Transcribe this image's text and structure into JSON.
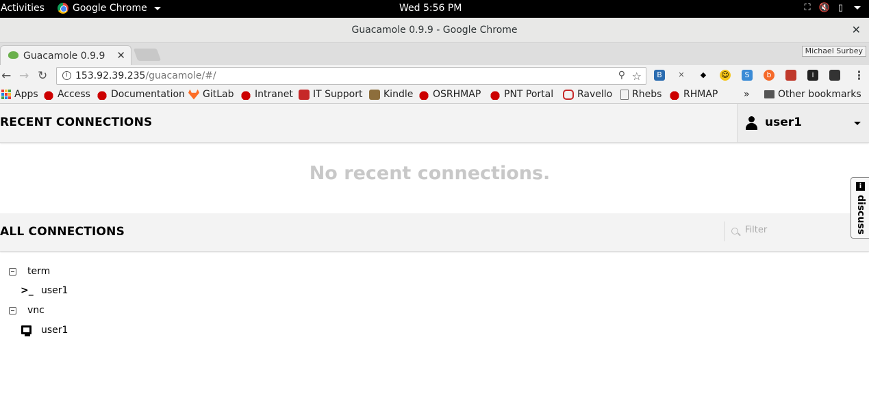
{
  "os_bar": {
    "activities": "Activities",
    "app_name": "Google Chrome",
    "clock": "Wed  5:56 PM"
  },
  "window": {
    "title": "Guacamole 0.9.9 - Google Chrome",
    "close": "✕"
  },
  "tabs": [
    {
      "label": "Guacamole 0.9.9",
      "close": "✕"
    }
  ],
  "profile_name": "Michael Surbey",
  "address": {
    "host": "153.92.39.235",
    "path": "/guacamole/#/"
  },
  "bookmarks": [
    {
      "label": "Apps",
      "icon": "apps-grid-icon"
    },
    {
      "label": "Access",
      "icon": "redhat-icon"
    },
    {
      "label": "Documentation",
      "icon": "redhat-icon"
    },
    {
      "label": "GitLab",
      "icon": "gitlab-icon"
    },
    {
      "label": "Intranet",
      "icon": "redhat-icon"
    },
    {
      "label": "IT Support",
      "icon": "servicenow-icon"
    },
    {
      "label": "Kindle",
      "icon": "kindle-icon"
    },
    {
      "label": "OSRHMAP",
      "icon": "redhat-icon"
    },
    {
      "label": "PNT Portal",
      "icon": "redhat-icon"
    },
    {
      "label": "Ravello",
      "icon": "oracle-icon"
    },
    {
      "label": "Rhebs",
      "icon": "page-icon"
    },
    {
      "label": "RHMAP",
      "icon": "redhat-icon"
    }
  ],
  "bookmarks_overflow": "»",
  "other_bookmarks": "Other bookmarks",
  "guac": {
    "recent_title": "RECENT CONNECTIONS",
    "user": "user1",
    "no_recent": "No recent connections.",
    "all_title": "ALL CONNECTIONS",
    "filter_placeholder": "Filter",
    "groups": [
      {
        "name": "term",
        "connections": [
          {
            "name": "user1",
            "protocol": "ssh"
          }
        ]
      },
      {
        "name": "vnc",
        "connections": [
          {
            "name": "user1",
            "protocol": "vnc"
          }
        ]
      }
    ]
  },
  "discuss": {
    "label": "discuss",
    "info": "i"
  },
  "colors": {
    "os_bar": "#000000",
    "no_recent_text": "#c8c8c8",
    "section_header_bg": "#f3f3f3"
  }
}
